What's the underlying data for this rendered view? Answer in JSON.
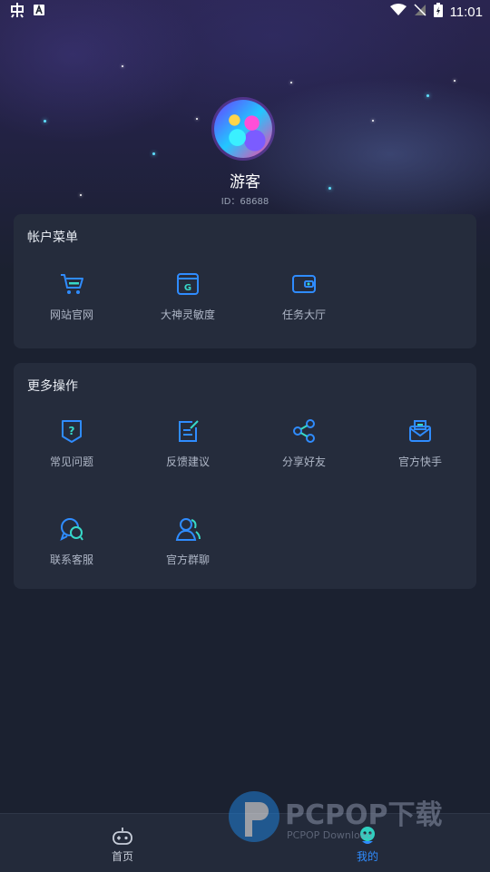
{
  "status_bar": {
    "time": "11:01"
  },
  "profile": {
    "name": "游客",
    "id_label": "ID：68688"
  },
  "account_menu": {
    "title": "帐户菜单",
    "items": [
      {
        "label": "网站官网",
        "icon": "cart-icon"
      },
      {
        "label": "大神灵敏度",
        "icon": "g-window-icon"
      },
      {
        "label": "任务大厅",
        "icon": "wallet-icon"
      }
    ]
  },
  "more_actions": {
    "title": "更多操作",
    "items": [
      {
        "label": "常见问题",
        "icon": "question-shield-icon"
      },
      {
        "label": "反馈建议",
        "icon": "edit-note-icon"
      },
      {
        "label": "分享好友",
        "icon": "share-icon"
      },
      {
        "label": "官方快手",
        "icon": "mail-icon"
      },
      {
        "label": "联系客服",
        "icon": "chat-icon"
      },
      {
        "label": "官方群聊",
        "icon": "group-icon"
      }
    ]
  },
  "tabbar": {
    "tabs": [
      {
        "label": "首页",
        "icon": "gamepad-icon",
        "active": false
      },
      {
        "label": "我的",
        "icon": "profile-icon",
        "active": true
      }
    ]
  },
  "watermark": {
    "text": "PCPOP下载",
    "sub": "PCPOP Download"
  },
  "colors": {
    "accent": "#2f8cff",
    "card_bg": "#252c3c",
    "page_bg": "#1b2130"
  }
}
